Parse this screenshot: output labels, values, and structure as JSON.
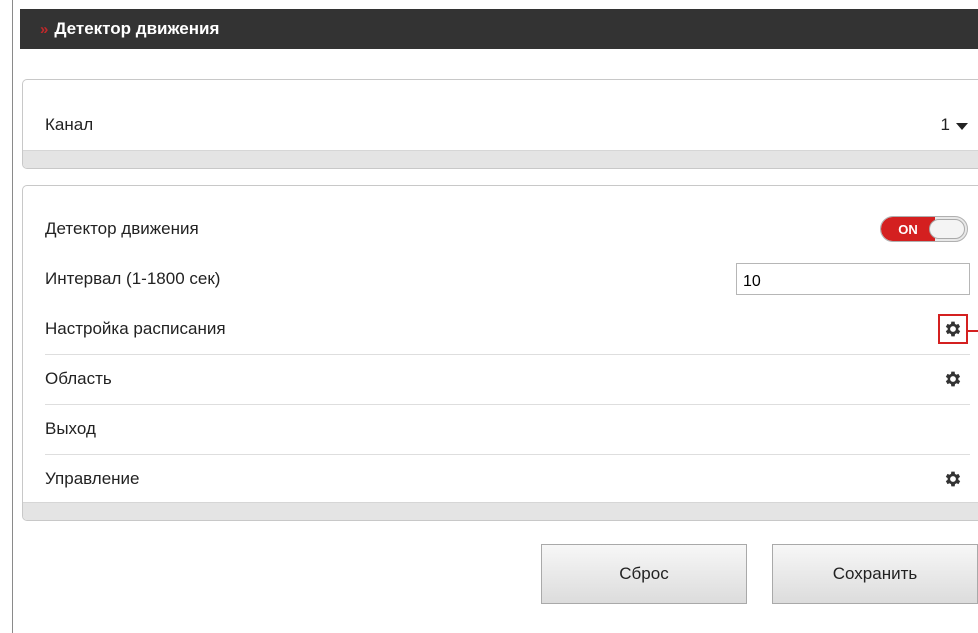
{
  "header": {
    "chevron": "»",
    "title": "Детектор движения"
  },
  "channel_panel": {
    "label": "Канал",
    "value": "1"
  },
  "settings": {
    "motion_detector": {
      "label": "Детектор движения",
      "toggle_text": "ON",
      "enabled": true
    },
    "interval": {
      "label": "Интервал (1-1800 сек)",
      "value": "10"
    },
    "schedule": {
      "label": "Настройка расписания",
      "icon": "gear-icon"
    },
    "area": {
      "label": "Область",
      "icon": "gear-icon"
    },
    "output": {
      "label": "Выход"
    },
    "control": {
      "label": "Управление",
      "icon": "gear-icon"
    }
  },
  "buttons": {
    "reset": "Сброс",
    "save": "Сохранить"
  },
  "colors": {
    "accent_red": "#d42020",
    "titlebar_bg": "#333333"
  }
}
